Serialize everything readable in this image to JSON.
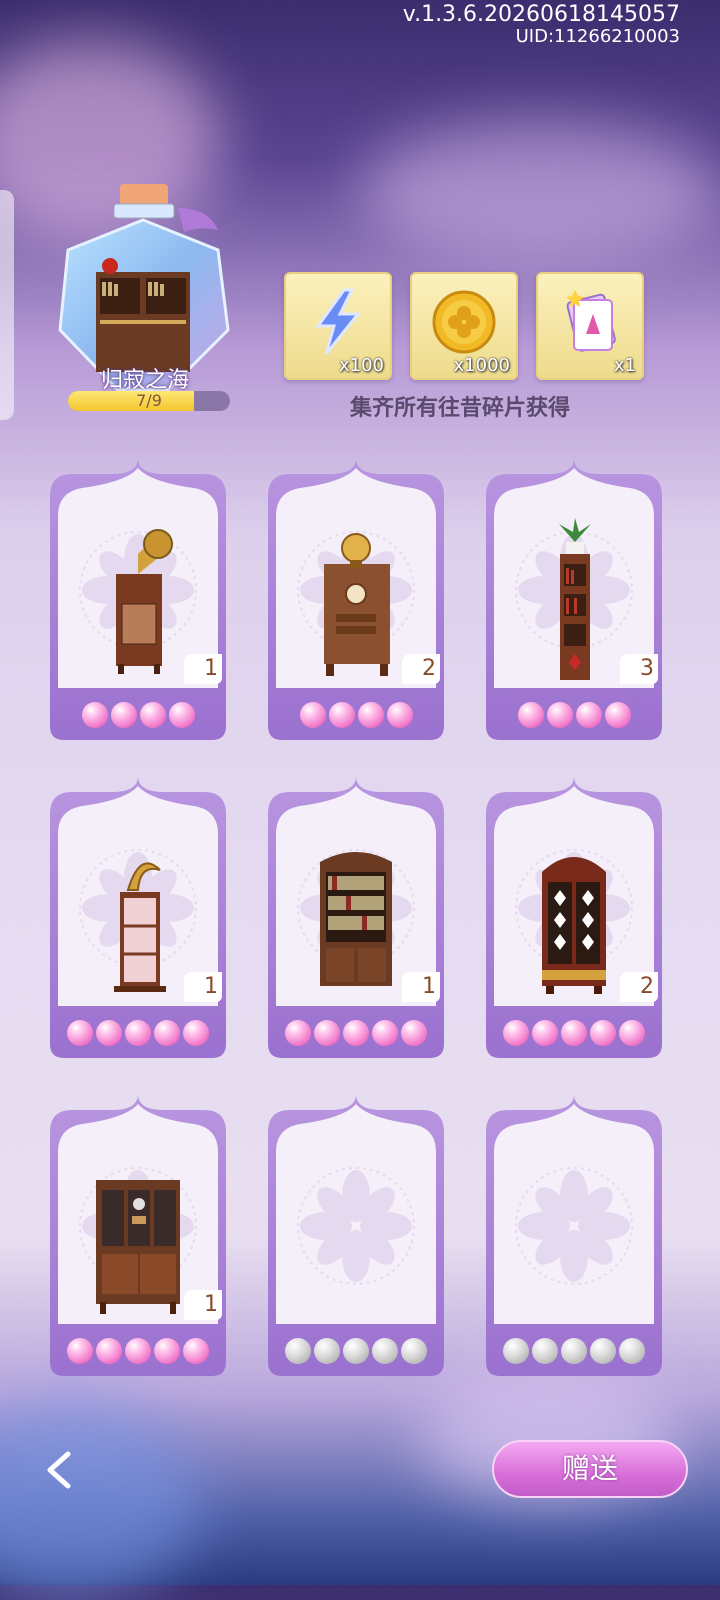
{
  "header": {
    "version": "v.1.3.6.20260618145057",
    "uid": "UID:11266210003"
  },
  "collection": {
    "name": "归寂之海",
    "progress_text": "7/9",
    "progress_fraction": 0.778
  },
  "rewards": [
    {
      "icon": "lightning-icon",
      "qty": "x100"
    },
    {
      "icon": "gold-coin-icon",
      "qty": "x1000"
    },
    {
      "icon": "card-pack-icon",
      "qty": "x1"
    }
  ],
  "hint": "集齐所有往昔碎片获得",
  "cards": [
    {
      "item": "gramophone-cabinet",
      "count": "1",
      "stars": 4,
      "collected": true
    },
    {
      "item": "clock-cabinet",
      "count": "2",
      "stars": 4,
      "collected": true
    },
    {
      "item": "tall-bookshelf-plant",
      "count": "3",
      "stars": 4,
      "collected": true
    },
    {
      "item": "display-shelf",
      "count": "1",
      "stars": 5,
      "collected": true
    },
    {
      "item": "bookcase",
      "count": "1",
      "stars": 5,
      "collected": true
    },
    {
      "item": "wardrobe",
      "count": "2",
      "stars": 5,
      "collected": true
    },
    {
      "item": "glass-cabinet",
      "count": "1",
      "stars": 5,
      "collected": true
    },
    {
      "item": "empty",
      "count": "",
      "stars": 5,
      "collected": false
    },
    {
      "item": "empty",
      "count": "",
      "stars": 5,
      "collected": false
    }
  ],
  "footer": {
    "gift_label": "赠送"
  }
}
